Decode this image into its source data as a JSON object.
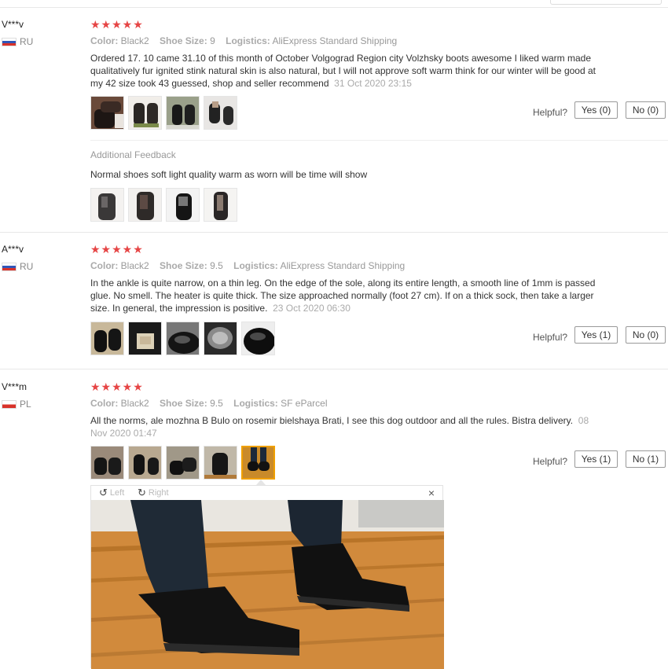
{
  "reviews": [
    {
      "name": "V***v",
      "country": "RU",
      "stars": "★★★★★",
      "color_label": "Color:",
      "color": "Black2",
      "size_label": "Shoe Size:",
      "size": "9",
      "logistics_label": "Logistics:",
      "logistics": "AliExpress Standard Shipping",
      "text": "Ordered 17. 10 came 31.10 of this month of October Volgograd Region city Volzhsky boots awesome I liked warm made qualitatively fur ignited stink natural skin is also natural, but I will not approve soft warm think for our winter will be good at my 42 size took 43 guessed, shop and seller recommend",
      "date": "31 Oct 2020 23:15",
      "helpful": "Helpful?",
      "yes": "Yes (0)",
      "no": "No (0)",
      "feedback_heading": "Additional Feedback",
      "feedback_text": "Normal shoes soft light quality warm as worn will be time will show"
    },
    {
      "name": "A***v",
      "country": "RU",
      "stars": "★★★★★",
      "color_label": "Color:",
      "color": "Black2",
      "size_label": "Shoe Size:",
      "size": "9.5",
      "logistics_label": "Logistics:",
      "logistics": "AliExpress Standard Shipping",
      "text": "In the ankle is quite narrow, on a thin leg. On the edge of the sole, along its entire length, a smooth line of 1mm is passed glue. No smell. The heater is quite thick. The size approached normally (foot 27 cm). If on a thick sock, then take a larger size. In general, the impression is positive.",
      "date": "23 Oct 2020 06:30",
      "helpful": "Helpful?",
      "yes": "Yes (1)",
      "no": "No (0)"
    },
    {
      "name": "V***m",
      "country": "PL",
      "stars": "★★★★★",
      "color_label": "Color:",
      "color": "Black2",
      "size_label": "Shoe Size:",
      "size": "9.5",
      "logistics_label": "Logistics:",
      "logistics": "SF eParcel",
      "text": "All the norms, ale mozhna B Bulo on rosemir bielshaya Brati, I see this dog outdoor and all the rules. Bistra delivery.",
      "date": "08 Nov 2020 01:47",
      "helpful": "Helpful?",
      "yes": "Yes (1)",
      "no": "No (1)"
    }
  ],
  "viewer": {
    "left_label": "Left",
    "right_label": "Right",
    "close": "×"
  },
  "colors": {
    "star": "#e64545",
    "selected_border": "#f0a000"
  }
}
